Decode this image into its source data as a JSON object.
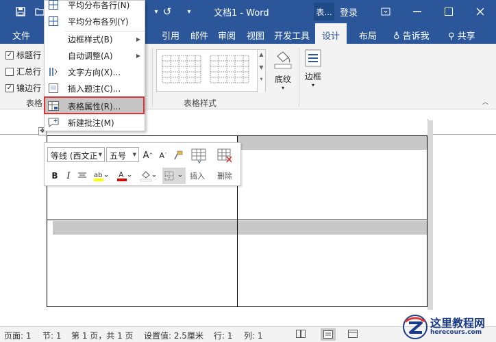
{
  "app": {
    "doc_title": "文档1 - Word",
    "context_tab": "表...",
    "login": "登录",
    "colors": {
      "accent": "#2b579a",
      "highlight_box": "#e03030"
    }
  },
  "ribbon_tabs": [
    "文件",
    "引用",
    "邮件",
    "审阅",
    "视图",
    "开发工具",
    "设计",
    "布局"
  ],
  "tell_me": "告诉我",
  "share": "共享",
  "table_style_options": {
    "header_row": "标题行",
    "total_row": "汇总行",
    "banded_rows": "镶边行",
    "group_label": "表格"
  },
  "table_styles": {
    "group_label": "表格样式"
  },
  "shading": {
    "label": "底纹"
  },
  "borders": {
    "label": "边框"
  },
  "context_menu": {
    "items": [
      {
        "label": "平均分布各行(N)",
        "icon": "distribute-rows-icon"
      },
      {
        "label": "平均分布各列(Y)",
        "icon": "distribute-columns-icon"
      },
      {
        "label": "边框样式(B)",
        "icon": ""
      },
      {
        "label": "自动调整(A)",
        "icon": ""
      },
      {
        "label": "文字方向(X)...",
        "icon": "text-direction-icon"
      },
      {
        "label": "插入题注(C)...",
        "icon": "insert-caption-icon"
      },
      {
        "label": "表格属性(R)...",
        "icon": "table-properties-icon"
      },
      {
        "label": "新建批注(M)",
        "icon": "new-comment-icon"
      }
    ]
  },
  "mini_toolbar": {
    "font": "等线 (西文正",
    "size": "五号",
    "insert": "插入",
    "delete": "删除"
  },
  "status_bar": {
    "page": "页面: 1",
    "section": "节: 1",
    "page_of": "第 1 页，共 1 页",
    "position": "设置值: 2.5厘米",
    "line": "行: 1",
    "column": "列: 1"
  },
  "watermark": {
    "title": "这里教程网",
    "url": "herecours.com"
  }
}
